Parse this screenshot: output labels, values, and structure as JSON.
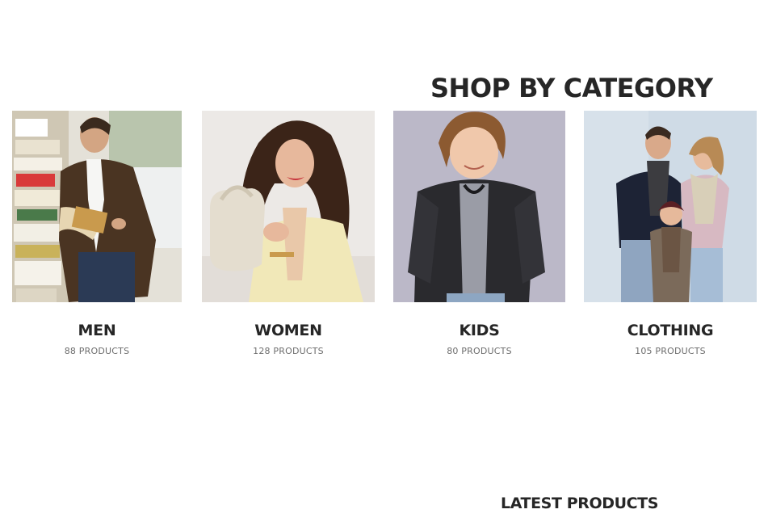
{
  "section": {
    "title": "SHOP BY CATEGORY"
  },
  "categories": [
    {
      "name": "MEN",
      "count": "88 PRODUCTS",
      "image": "man-reading-magazine-photo",
      "bg_color": "#d9d3c6"
    },
    {
      "name": "WOMEN",
      "count": "128 PRODUCTS",
      "image": "woman-with-handbag-photo",
      "bg_color": "#ece7e3"
    },
    {
      "name": "KIDS",
      "count": "80 PRODUCTS",
      "image": "boy-in-leather-jacket-photo",
      "bg_color": "#bbb8c7"
    },
    {
      "name": "CLOTHING",
      "count": "105 PRODUCTS",
      "image": "family-portrait-photo",
      "bg_color": "#cdd8e4"
    }
  ],
  "latest": {
    "title": "LATEST PRODUCTS"
  }
}
